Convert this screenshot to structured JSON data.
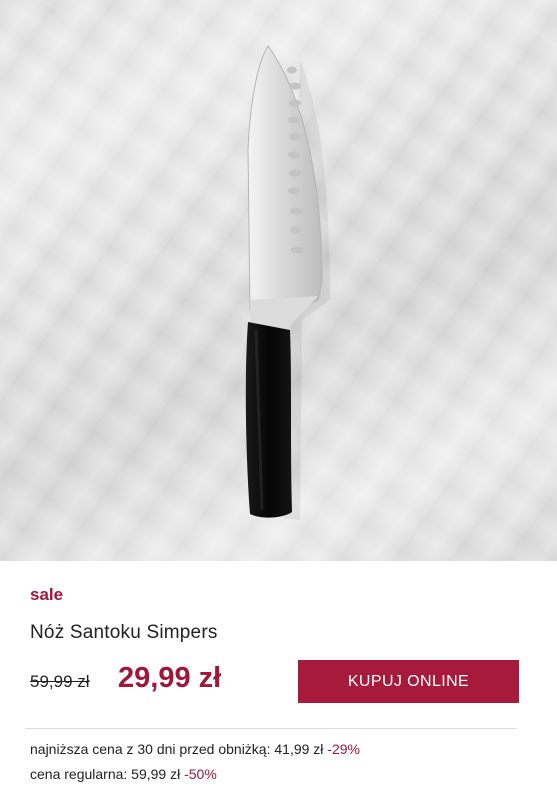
{
  "product": {
    "badge": "sale",
    "name": "Nóż Santoku Simpers",
    "old_price": "59,99 zł",
    "price": "29,99 zł",
    "buy_label": "KUPUJ ONLINE",
    "lowest_price_label": "najniższa cena z 30 dni przed obniżką: 41,99 zł",
    "lowest_price_discount": "-29%",
    "regular_price_label": "cena regularna: 59,99 zł",
    "regular_price_discount": "-50%"
  },
  "colors": {
    "accent": "#a81a3c",
    "background": "#ffffff",
    "marble": "#e3e3e3"
  }
}
